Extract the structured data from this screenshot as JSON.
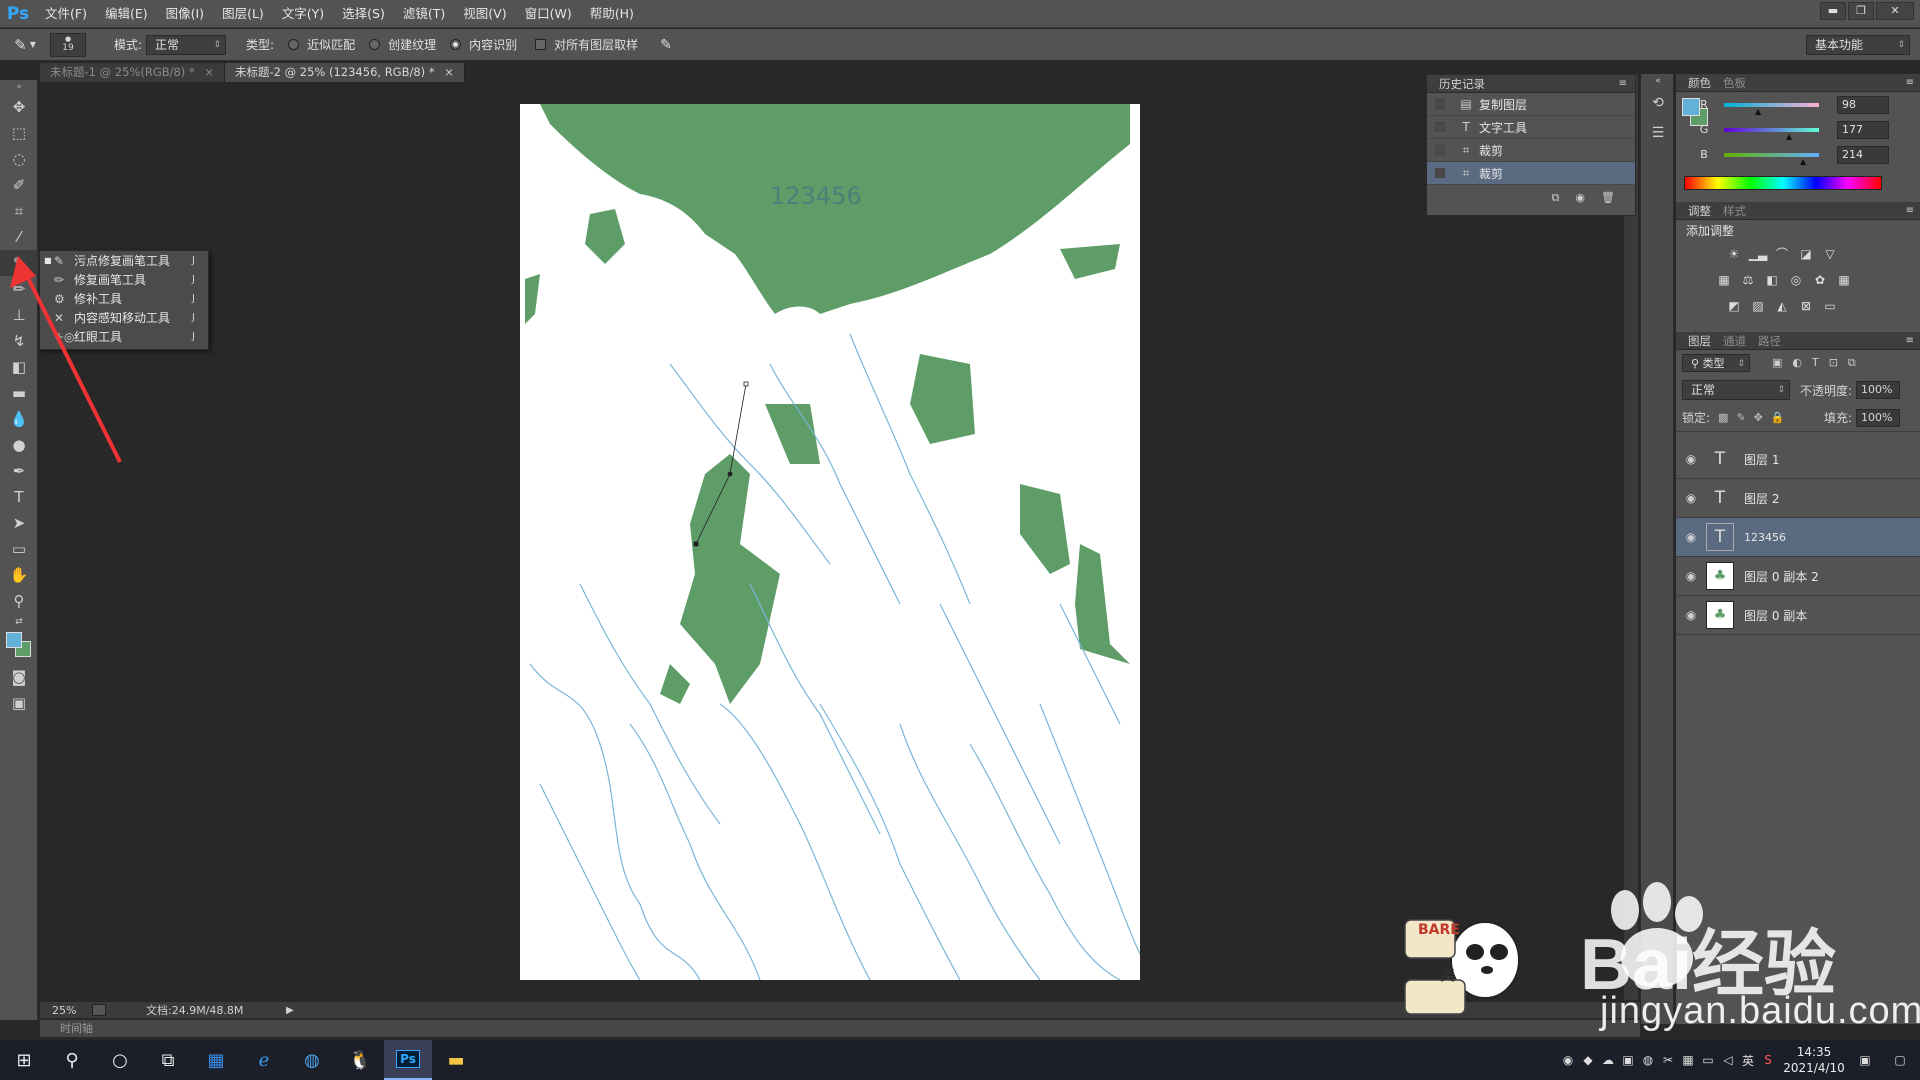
{
  "app": {
    "logo": "Ps"
  },
  "menu": [
    "文件(F)",
    "编辑(E)",
    "图像(I)",
    "图层(L)",
    "文字(Y)",
    "选择(S)",
    "滤镜(T)",
    "视图(V)",
    "窗口(W)",
    "帮助(H)"
  ],
  "window_controls": {
    "minimize": "▬",
    "restore": "❐",
    "close": "✕"
  },
  "options": {
    "brush_size": "19",
    "mode_label": "模式:",
    "mode_value": "正常",
    "type_label": "类型:",
    "type_options": [
      "近似匹配",
      "创建纹理",
      "内容识别"
    ],
    "sample_all_label": "对所有图层取样",
    "workspace": "基本功能"
  },
  "tabs": [
    "未标题-1 @ 25%(RGB/8) *",
    "未标题-2 @ 25% (123456, RGB/8) *"
  ],
  "tab_close": "×",
  "flyout": [
    {
      "label": "污点修复画笔工具",
      "key": "J",
      "icon": "spot-healing-brush-icon"
    },
    {
      "label": "修复画笔工具",
      "key": "J",
      "icon": "healing-brush-icon"
    },
    {
      "label": "修补工具",
      "key": "J",
      "icon": "patch-icon"
    },
    {
      "label": "内容感知移动工具",
      "key": "J",
      "icon": "content-aware-move-icon"
    },
    {
      "label": "红眼工具",
      "key": "J",
      "icon": "red-eye-icon"
    }
  ],
  "canvas": {
    "text": "123456",
    "green": "#5e9d68",
    "blue": "#7ab6d8"
  },
  "status": {
    "zoom": "25%",
    "doc": "文档:24.9M/48.8M"
  },
  "timeline_label": "时间轴",
  "history": {
    "title": "历史记录",
    "items": [
      "复制图层",
      "文字工具",
      "裁剪",
      "裁剪"
    ]
  },
  "color": {
    "tabs": [
      "颜色",
      "色板"
    ],
    "r_label": "R",
    "g_label": "G",
    "b_label": "B",
    "r": "98",
    "g": "177",
    "b": "214",
    "fg": "#62b1d6",
    "bg": "#5e9d68"
  },
  "adjustments": {
    "tabs": [
      "调整",
      "样式"
    ],
    "add_label": "添加调整"
  },
  "layers": {
    "tabs": [
      "图层",
      "通道",
      "路径"
    ],
    "filter": "类型",
    "blend": "正常",
    "opacity_label": "不透明度:",
    "opacity": "100%",
    "lock_label": "锁定:",
    "fill_label": "填充:",
    "fill": "100%",
    "items": [
      {
        "name": "图层 1",
        "kind": "text"
      },
      {
        "name": "图层 2",
        "kind": "text"
      },
      {
        "name": "123456",
        "kind": "text"
      },
      {
        "name": "图层 0 副本 2",
        "kind": "image"
      },
      {
        "name": "图层 0 副本",
        "kind": "image"
      }
    ]
  },
  "taskbar": {
    "ime": "英",
    "time": "14:35",
    "date": "2021/4/10"
  },
  "watermark": {
    "brand": "Bai经验",
    "url": "jingyan.baidu.com"
  }
}
